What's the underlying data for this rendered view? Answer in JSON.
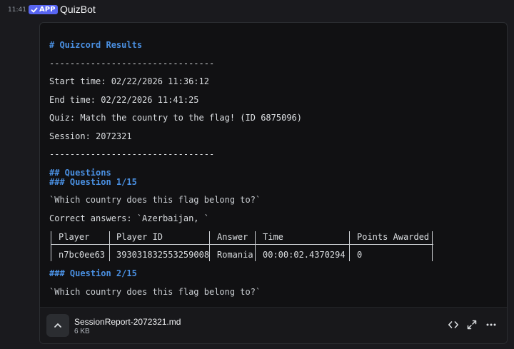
{
  "message": {
    "timestamp": "11:41",
    "badge": "APP",
    "author": "QuizBot"
  },
  "preview": {
    "lines": [
      "# Quizcord Results",
      "--------------------------------",
      "Start time: 02/22/2026 11:36:12",
      "End time: 02/22/2026 11:41:25",
      "Quiz: Match the country to the flag! (ID 6875096)",
      "Session: 2072321",
      "--------------------------------",
      "## Questions",
      "### Question 1/15",
      "`Which country does this flag belong to?`",
      "Correct answers: `Azerbaijan, `",
      "### Question 2/15",
      "`Which country does this flag belong to?`"
    ],
    "table": {
      "headers": [
        "Player",
        "Player ID",
        "Answer",
        "Time",
        "Points Awarded"
      ],
      "rows": [
        [
          "n7bc0ee63",
          "393031832553259008",
          "Romania",
          "00:00:02.4370294",
          "0"
        ]
      ]
    }
  },
  "attachment": {
    "file_name": "SessionReport-2072321.md",
    "file_size": "6 KB"
  },
  "icons": {
    "badge_check": "checkmark-icon",
    "toggle": "chevron-up-icon",
    "code": "code-icon",
    "expand": "expand-icon",
    "more": "more-icon"
  },
  "colors": {
    "background": "#1a1a1e",
    "attachment_bg": "#111113",
    "badge": "#5865f2",
    "markdown_heading": "#4a90e2"
  }
}
